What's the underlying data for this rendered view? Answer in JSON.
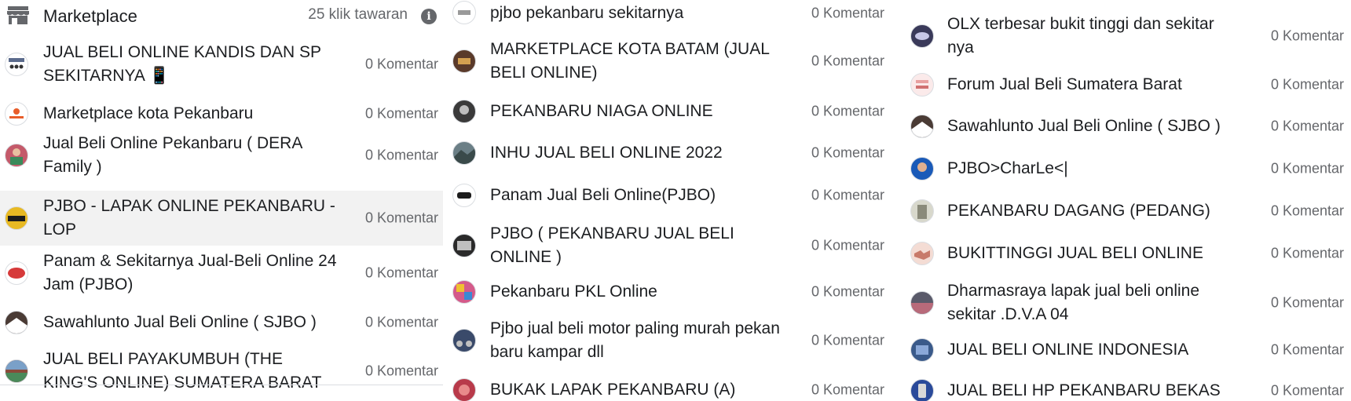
{
  "marketplace": {
    "title": "Marketplace",
    "clicks": "25 klik tawaran",
    "info_icon": "i"
  },
  "groups_col1": [
    {
      "name": "JUAL BELI ONLINE KANDIS DAN SP SEKITARNYA 📱",
      "count": "0 Komentar",
      "color": "#5b6b8c"
    },
    {
      "name": "Marketplace kota Pekanbaru",
      "count": "0 Komentar",
      "color": "#e85d2a"
    },
    {
      "name": "Jual Beli Online Pekanbaru ( DERA Family )",
      "count": "0 Komentar",
      "color": "#c45a6a"
    },
    {
      "name": "PJBO - LAPAK ONLINE PEKANBARU - LOP",
      "count": "0 Komentar",
      "color": "#e8b923"
    },
    {
      "name": "Panam & Sekitarnya Jual-Beli Online 24 Jam (PJBO)",
      "count": "0 Komentar",
      "color": "#d63a3a"
    },
    {
      "name": "Sawahlunto Jual Beli Online ( SJBO )",
      "count": "0 Komentar",
      "color": "#4a3b35"
    },
    {
      "name": "JUAL BELI PAYAKUMBUH (THE KING'S ONLINE) SUMATERA BARAT",
      "count": "0 Komentar",
      "color": "#8a4a3a"
    }
  ],
  "groups_col2": [
    {
      "name": "pjbo pekanbaru sekitarnya",
      "count": "0 Komentar",
      "color": "#9a9a9a"
    },
    {
      "name": "MARKETPLACE KOTA BATAM (JUAL BELI ONLINE)",
      "count": "0 Komentar",
      "color": "#5a3a2a"
    },
    {
      "name": "PEKANBARU NIAGA ONLINE",
      "count": "0 Komentar",
      "color": "#3a3a3a"
    },
    {
      "name": "INHU JUAL BELI ONLINE 2022",
      "count": "0 Komentar",
      "color": "#6b7f86"
    },
    {
      "name": "Panam Jual Beli Online(PJBO)",
      "count": "0 Komentar",
      "color": "#1c1c1c"
    },
    {
      "name": "PJBO ( PEKANBARU JUAL BELI ONLINE )",
      "count": "0 Komentar",
      "color": "#2a2a2a"
    },
    {
      "name": "Pekanbaru PKL Online",
      "count": "0 Komentar",
      "color": "#d45a8a"
    },
    {
      "name": "Pjbo jual beli motor paling murah pekan baru kampar dll",
      "count": "0 Komentar",
      "color": "#3a4a6a"
    },
    {
      "name": "BUKAK LAPAK PEKANBARU (A)",
      "count": "0 Komentar",
      "color": "#b83a4a"
    }
  ],
  "groups_col3": [
    {
      "name": "OLX terbesar bukit tinggi dan sekitar nya",
      "count": "0 Komentar",
      "color": "#3a3a5a"
    },
    {
      "name": "Forum Jual Beli Sumatera Barat",
      "count": "0 Komentar",
      "color": "#e8a0a0"
    },
    {
      "name": "Sawahlunto Jual Beli Online ( SJBO )",
      "count": "0 Komentar",
      "color": "#4a3b35"
    },
    {
      "name": "PJBO>CharLe<|",
      "count": "0 Komentar",
      "color": "#1a5ab8"
    },
    {
      "name": "PEKANBARU DAGANG (PEDANG)",
      "count": "0 Komentar",
      "color": "#8a8a7a"
    },
    {
      "name": "BUKITTINGGI JUAL BELI ONLINE",
      "count": "0 Komentar",
      "color": "#c87a6a"
    },
    {
      "name": "Dharmasraya lapak jual beli online sekitar .D.V.A 04",
      "count": "0 Komentar",
      "color": "#5a5a6a"
    },
    {
      "name": "JUAL BELI ONLINE INDONESIA",
      "count": "0 Komentar",
      "color": "#3a5a8a"
    },
    {
      "name": "JUAL BELI HP PEKANBARU BEKAS",
      "count": "0 Komentar",
      "color": "#2a4a9a"
    }
  ]
}
